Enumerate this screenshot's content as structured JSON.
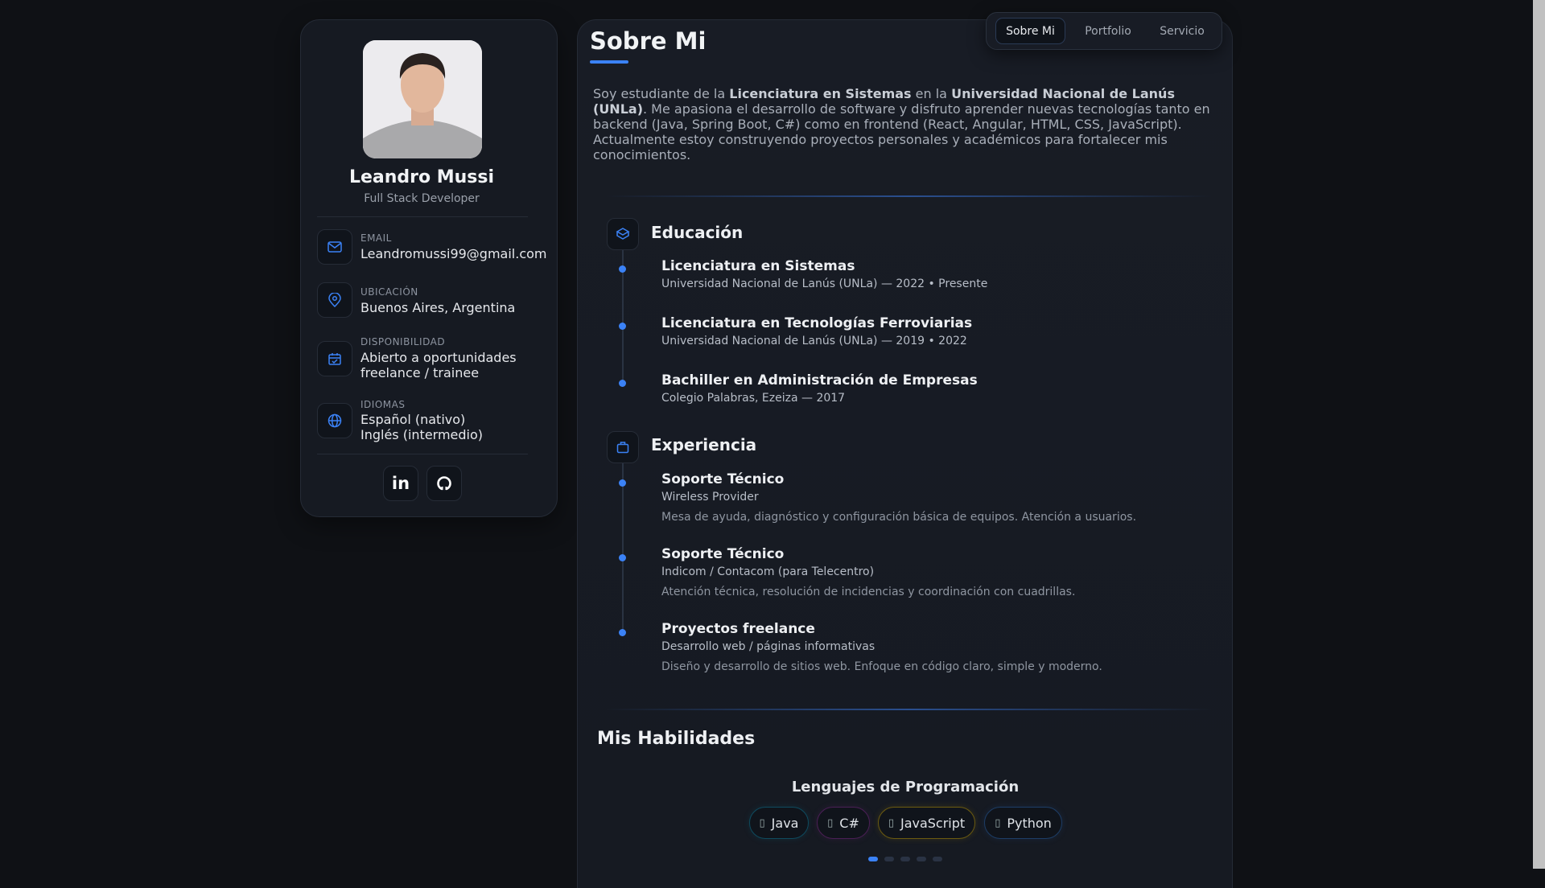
{
  "profile": {
    "name": "Leandro Mussi",
    "role": "Full Stack Developer",
    "contacts": [
      {
        "label": "EMAIL",
        "value": "Leandromussi99@gmail.com",
        "icon": "mail-icon"
      },
      {
        "label": "UBICACIÓN",
        "value": "Buenos Aires, Argentina",
        "icon": "map-pin-icon"
      },
      {
        "label": "DISPONIBILIDAD",
        "value": "Abierto a oportunidades",
        "value2": "freelance / trainee",
        "icon": "calendar-check-icon"
      },
      {
        "label": "IDIOMAS",
        "value": "Español (nativo)",
        "value2": "Inglés (intermedio)",
        "icon": "globe-icon"
      }
    ],
    "social": [
      "linkedin-icon",
      "github-icon"
    ]
  },
  "nav": {
    "items": [
      "Sobre Mi",
      "Portfolio",
      "Servicio"
    ],
    "active": "Sobre Mi"
  },
  "about": {
    "title": "Sobre Mi",
    "p1": "Soy estudiante de la ",
    "b1": "Licenciatura en Sistemas",
    "p2": " en la ",
    "b2": "Universidad Nacional de Lanús (UNLa)",
    "p3": ". Me apasiona el desarrollo de software y disfruto aprender nuevas tecnologías tanto en backend (Java, Spring Boot, C#) como en frontend (React, Angular, HTML, CSS, JavaScript). Actualmente estoy construyendo proyectos personales y académicos para fortalecer mis conocimientos."
  },
  "education": {
    "heading": "Educación",
    "items": [
      {
        "title": "Licenciatura en Sistemas",
        "sub": "Universidad Nacional de Lanús (UNLa) — 2022 • Presente"
      },
      {
        "title": "Licenciatura en Tecnologías Ferroviarias",
        "sub": "Universidad Nacional de Lanús (UNLa) — 2019 • 2022"
      },
      {
        "title": "Bachiller en Administración de Empresas",
        "sub": "Colegio Palabras, Ezeiza — 2017"
      }
    ]
  },
  "experience": {
    "heading": "Experiencia",
    "items": [
      {
        "title": "Soporte Técnico",
        "sub": "Wireless Provider",
        "desc": "Mesa de ayuda, diagnóstico y configuración básica de equipos. Atención a usuarios."
      },
      {
        "title": "Soporte Técnico",
        "sub": "Indicom / Contacom (para Telecentro)",
        "desc": "Atención técnica, resolución de incidencias y coordinación con cuadrillas."
      },
      {
        "title": "Proyectos freelance",
        "sub": "Desarrollo web / páginas informativas",
        "desc": "Diseño y desarrollo de sitios web. Enfoque en código claro, simple y moderno."
      }
    ]
  },
  "skills": {
    "heading": "Mis Habilidades",
    "group": "Lenguajes de Programación",
    "items": [
      {
        "label": "Java",
        "color": "#0e4a5e"
      },
      {
        "label": "C#",
        "color": "#4a1f55"
      },
      {
        "label": "JavaScript",
        "color": "#6b5a10"
      },
      {
        "label": "Python",
        "color": "#1d3d66"
      }
    ],
    "carousel_pages": 5,
    "carousel_active": 1
  },
  "colors": {
    "accent": "#3b82f6",
    "background": "#0f1115",
    "card": "#161a22"
  }
}
